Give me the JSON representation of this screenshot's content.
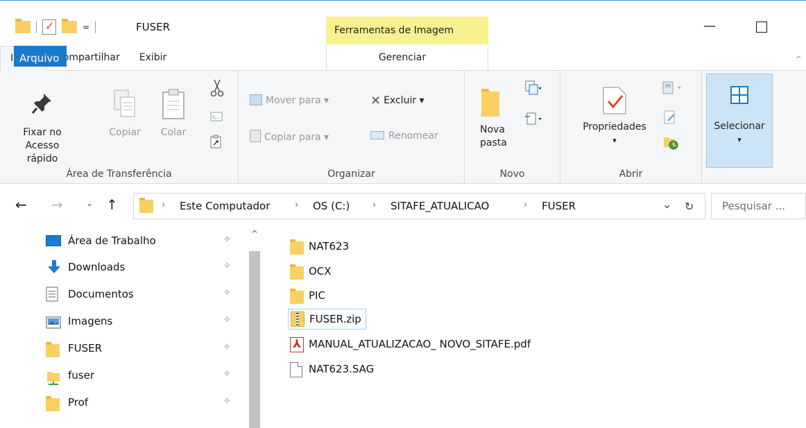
{
  "window": {
    "title": "FUSER",
    "qat_dropdown": "=",
    "context_tools_label": "Ferramentas de Imagem",
    "minimize_glyph": "—"
  },
  "tabs": [
    {
      "label": "Arquivo"
    },
    {
      "label": "Início"
    },
    {
      "label": "Compartilhar"
    },
    {
      "label": "Exibir"
    },
    {
      "label": "Gerenciar"
    }
  ],
  "ribbon": {
    "clipboard": {
      "pin_line1": "Fixar no",
      "pin_line2": "Acesso rápido",
      "copy": "Copiar",
      "paste": "Colar",
      "group": "Área de Transferência"
    },
    "organize": {
      "move_to": "Mover para ▾",
      "copy_to": "Copiar para ▾",
      "delete": "Excluir ▾",
      "rename": "Renomear",
      "group": "Organizar"
    },
    "new": {
      "folder_line1": "Nova",
      "folder_line2": "pasta",
      "group": "Novo"
    },
    "open": {
      "properties": "Propriedades",
      "properties_caret": "▾",
      "group": "Abrir"
    },
    "select": {
      "label": "Selecionar",
      "caret": "▾"
    }
  },
  "address": {
    "crumbs": [
      "Este Computador",
      "OS (C:)",
      "SITAFE_ATUALICAO",
      "FUSER"
    ],
    "separator": "›",
    "history_caret": "⌄",
    "refresh_glyph": "↻",
    "search_placeholder": "Pesquisar ..."
  },
  "navpane": {
    "items": [
      {
        "label": "Área de Trabalho",
        "icon": "desktop-icon"
      },
      {
        "label": "Downloads",
        "icon": "downloads-icon"
      },
      {
        "label": "Documentos",
        "icon": "documents-icon"
      },
      {
        "label": "Imagens",
        "icon": "pictures-icon"
      },
      {
        "label": "FUSER",
        "icon": "folder-icon"
      },
      {
        "label": "fuser",
        "icon": "network-folder-icon"
      },
      {
        "label": "Prof",
        "icon": "folder-icon"
      }
    ],
    "pin_glyph": "📌"
  },
  "files": [
    {
      "name": "NAT623",
      "type": "folder"
    },
    {
      "name": "OCX",
      "type": "folder"
    },
    {
      "name": "PIC",
      "type": "folder"
    },
    {
      "name": "FUSER.zip",
      "type": "zip",
      "selected": true
    },
    {
      "name": "MANUAL_ATUALIZACAO_ NOVO_SITAFE.pdf",
      "type": "pdf"
    },
    {
      "name": "NAT623.SAG",
      "type": "file"
    }
  ],
  "colors": {
    "file_tab": "#1979ca",
    "context_tab": "#f7f18f",
    "folder": "#f8d063",
    "selection_border": "#99d1ff"
  }
}
